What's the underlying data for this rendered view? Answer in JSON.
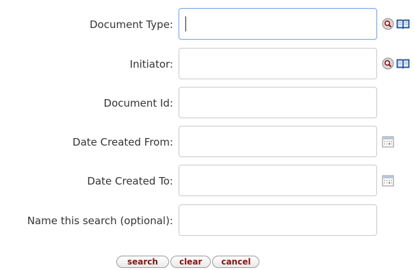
{
  "fields": [
    {
      "label": "Document Type:",
      "value": "",
      "icons": [
        "search-magnifier-icon",
        "book-lookup-icon"
      ]
    },
    {
      "label": "Initiator:",
      "value": "",
      "icons": [
        "search-magnifier-icon",
        "book-lookup-icon"
      ]
    },
    {
      "label": "Document Id:",
      "value": "",
      "icons": []
    },
    {
      "label": "Date Created From:",
      "value": "",
      "icons": [
        "calendar-icon"
      ]
    },
    {
      "label": "Date Created To:",
      "value": "",
      "icons": [
        "calendar-icon"
      ]
    },
    {
      "label": "Name this search (optional):",
      "value": "",
      "icons": []
    }
  ],
  "buttons": {
    "search": "search",
    "clear": "clear",
    "cancel": "cancel"
  },
  "colors": {
    "button_text": "#8a1111",
    "focus_border": "#7aa7e8"
  }
}
